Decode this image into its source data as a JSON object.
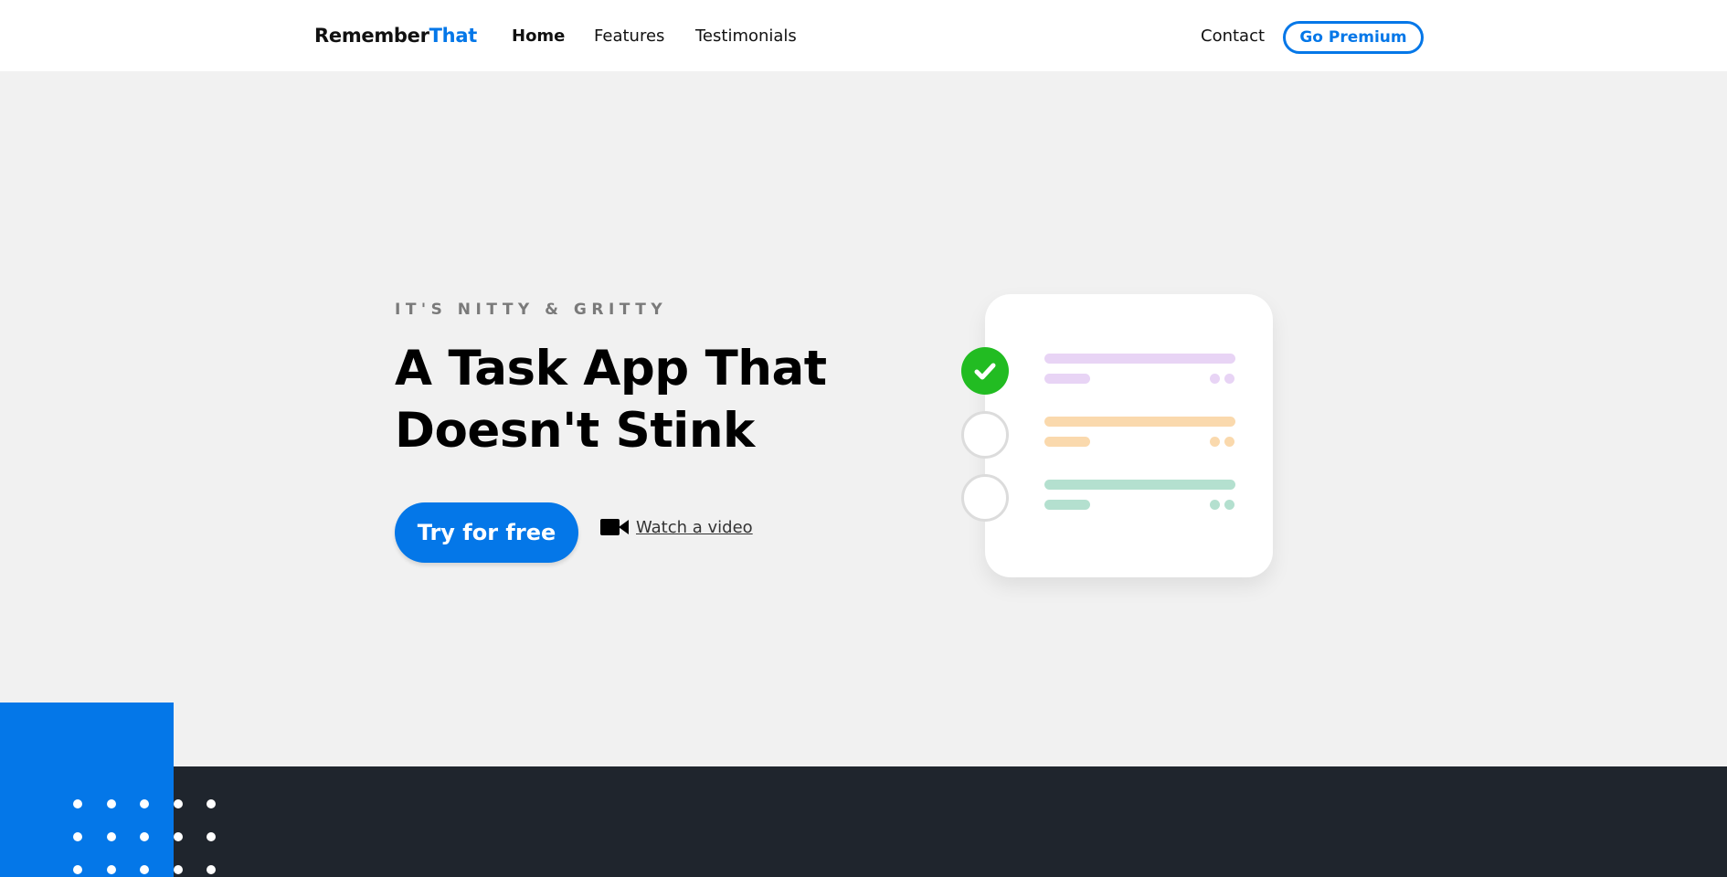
{
  "nav": {
    "logo_part1": "Remember",
    "logo_part2": "That",
    "links": [
      {
        "label": "Home"
      },
      {
        "label": "Features"
      },
      {
        "label": "Testimonials"
      }
    ],
    "contact_label": "Contact",
    "premium_label": "Go Premium"
  },
  "hero": {
    "eyebrow": "IT'S NITTY & GRITTY",
    "headline_line1": "A Task App That",
    "headline_line2": "Doesn't Stink",
    "cta_label": "Try for free",
    "video_label": "Watch a video"
  },
  "illustration": {
    "tasks": [
      {
        "state": "done",
        "color": "#e8d4f5"
      },
      {
        "state": "open",
        "color": "#fad9ad"
      },
      {
        "state": "open",
        "color": "#b4e0cf"
      }
    ],
    "check_color": "#22bc22"
  },
  "colors": {
    "accent": "#0477e8",
    "dark": "#1f252d",
    "background": "#f1f1f1"
  }
}
